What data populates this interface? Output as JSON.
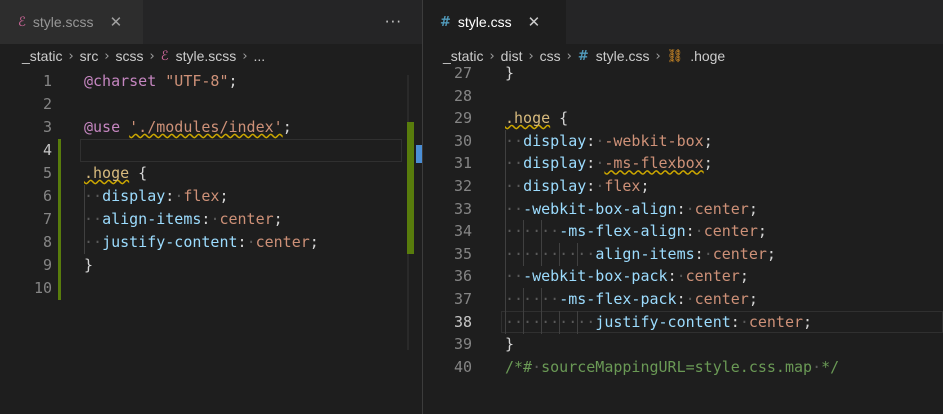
{
  "left": {
    "tab": {
      "icon": "sass-icon",
      "label": "style.scss",
      "close": "✕"
    },
    "more": "···",
    "breadcrumb": {
      "items": [
        "_static",
        "src",
        "scss",
        "style.scss",
        "..."
      ],
      "sep": "›"
    },
    "lines": [
      {
        "n": "1",
        "tokens": [
          {
            "t": "@charset",
            "c": "kw-at"
          },
          {
            "t": " ",
            "c": "punc"
          },
          {
            "t": "\"UTF-8\"",
            "c": "str"
          },
          {
            "t": ";",
            "c": "punc"
          }
        ]
      },
      {
        "n": "2",
        "tokens": []
      },
      {
        "n": "3",
        "tokens": [
          {
            "t": "@use",
            "c": "kw-at"
          },
          {
            "t": " ",
            "c": "punc"
          },
          {
            "t": "'./modules/index'",
            "c": "str squig"
          },
          {
            "t": ";",
            "c": "punc"
          }
        ]
      },
      {
        "n": "4",
        "tokens": []
      },
      {
        "n": "5",
        "tokens": [
          {
            "t": ".hoge",
            "c": "sel squig"
          },
          {
            "t": " {",
            "c": "punc"
          }
        ]
      },
      {
        "n": "6",
        "tokens": [
          {
            "t": "··",
            "c": "dot-ws"
          },
          {
            "t": "display",
            "c": "prop"
          },
          {
            "t": ":",
            "c": "punc"
          },
          {
            "t": "·",
            "c": "dot-ws"
          },
          {
            "t": "flex",
            "c": "val"
          },
          {
            "t": ";",
            "c": "punc"
          }
        ]
      },
      {
        "n": "7",
        "tokens": [
          {
            "t": "··",
            "c": "dot-ws"
          },
          {
            "t": "align-items",
            "c": "prop"
          },
          {
            "t": ":",
            "c": "punc"
          },
          {
            "t": "·",
            "c": "dot-ws"
          },
          {
            "t": "center",
            "c": "val"
          },
          {
            "t": ";",
            "c": "punc"
          }
        ]
      },
      {
        "n": "8",
        "tokens": [
          {
            "t": "··",
            "c": "dot-ws"
          },
          {
            "t": "justify-content",
            "c": "prop"
          },
          {
            "t": ":",
            "c": "punc"
          },
          {
            "t": "·",
            "c": "dot-ws"
          },
          {
            "t": "center",
            "c": "val"
          },
          {
            "t": ";",
            "c": "punc"
          }
        ]
      },
      {
        "n": "9",
        "tokens": [
          {
            "t": "}",
            "c": "punc"
          }
        ]
      },
      {
        "n": "10",
        "tokens": []
      }
    ],
    "current_line": "4"
  },
  "right": {
    "tab": {
      "icon": "css-hash-icon",
      "glyph": "#",
      "label": "style.css",
      "close": "✕"
    },
    "breadcrumb": {
      "items": [
        "_static",
        "dist",
        "css",
        "style.css",
        ".hoge"
      ],
      "sep": "›"
    },
    "lines": [
      {
        "n": "27",
        "tokens": [
          {
            "t": "}",
            "c": "punc"
          }
        ]
      },
      {
        "n": "28",
        "tokens": []
      },
      {
        "n": "29",
        "tokens": [
          {
            "t": ".hoge",
            "c": "sel squig"
          },
          {
            "t": " {",
            "c": "punc"
          }
        ]
      },
      {
        "n": "30",
        "tokens": [
          {
            "t": "··",
            "c": "dot-ws"
          },
          {
            "t": "display",
            "c": "prop"
          },
          {
            "t": ":",
            "c": "punc"
          },
          {
            "t": "·",
            "c": "dot-ws"
          },
          {
            "t": "-webkit-box",
            "c": "val"
          },
          {
            "t": ";",
            "c": "punc"
          }
        ]
      },
      {
        "n": "31",
        "tokens": [
          {
            "t": "··",
            "c": "dot-ws"
          },
          {
            "t": "display",
            "c": "prop"
          },
          {
            "t": ":",
            "c": "punc"
          },
          {
            "t": "·",
            "c": "dot-ws"
          },
          {
            "t": "-ms-flexbox",
            "c": "val squig"
          },
          {
            "t": ";",
            "c": "punc"
          }
        ]
      },
      {
        "n": "32",
        "tokens": [
          {
            "t": "··",
            "c": "dot-ws"
          },
          {
            "t": "display",
            "c": "prop"
          },
          {
            "t": ":",
            "c": "punc"
          },
          {
            "t": "·",
            "c": "dot-ws"
          },
          {
            "t": "flex",
            "c": "val"
          },
          {
            "t": ";",
            "c": "punc"
          }
        ]
      },
      {
        "n": "33",
        "tokens": [
          {
            "t": "··",
            "c": "dot-ws"
          },
          {
            "t": "-webkit-box-align",
            "c": "prop"
          },
          {
            "t": ":",
            "c": "punc"
          },
          {
            "t": "·",
            "c": "dot-ws"
          },
          {
            "t": "center",
            "c": "val"
          },
          {
            "t": ";",
            "c": "punc"
          }
        ]
      },
      {
        "n": "34",
        "tokens": [
          {
            "t": "······",
            "c": "dot-ws"
          },
          {
            "t": "-ms-flex-align",
            "c": "prop"
          },
          {
            "t": ":",
            "c": "punc"
          },
          {
            "t": "·",
            "c": "dot-ws"
          },
          {
            "t": "center",
            "c": "val"
          },
          {
            "t": ";",
            "c": "punc"
          }
        ]
      },
      {
        "n": "35",
        "tokens": [
          {
            "t": "··········",
            "c": "dot-ws"
          },
          {
            "t": "align-items",
            "c": "prop"
          },
          {
            "t": ":",
            "c": "punc"
          },
          {
            "t": "·",
            "c": "dot-ws"
          },
          {
            "t": "center",
            "c": "val"
          },
          {
            "t": ";",
            "c": "punc"
          }
        ]
      },
      {
        "n": "36",
        "tokens": [
          {
            "t": "··",
            "c": "dot-ws"
          },
          {
            "t": "-webkit-box-pack",
            "c": "prop"
          },
          {
            "t": ":",
            "c": "punc"
          },
          {
            "t": "·",
            "c": "dot-ws"
          },
          {
            "t": "center",
            "c": "val"
          },
          {
            "t": ";",
            "c": "punc"
          }
        ]
      },
      {
        "n": "37",
        "tokens": [
          {
            "t": "······",
            "c": "dot-ws"
          },
          {
            "t": "-ms-flex-pack",
            "c": "prop"
          },
          {
            "t": ":",
            "c": "punc"
          },
          {
            "t": "·",
            "c": "dot-ws"
          },
          {
            "t": "center",
            "c": "val"
          },
          {
            "t": ";",
            "c": "punc"
          }
        ]
      },
      {
        "n": "38",
        "tokens": [
          {
            "t": "··········",
            "c": "dot-ws"
          },
          {
            "t": "justify-content",
            "c": "prop"
          },
          {
            "t": ":",
            "c": "punc"
          },
          {
            "t": "·",
            "c": "dot-ws"
          },
          {
            "t": "center",
            "c": "val"
          },
          {
            "t": ";",
            "c": "punc"
          }
        ]
      },
      {
        "n": "39",
        "tokens": [
          {
            "t": "}",
            "c": "punc"
          }
        ]
      },
      {
        "n": "40",
        "tokens": [
          {
            "t": "/*#",
            "c": "cmt"
          },
          {
            "t": "·",
            "c": "dot-ws"
          },
          {
            "t": "sourceMappingURL=style.css.map",
            "c": "cmt"
          },
          {
            "t": "·",
            "c": "dot-ws"
          },
          {
            "t": "*/",
            "c": "cmt"
          }
        ]
      }
    ],
    "current_line": "38"
  },
  "colors": {
    "scss_icon": "#cd6799",
    "css_icon": "#519aba",
    "symbol_icon": "#ee9d28",
    "modified": "#587c0c"
  }
}
